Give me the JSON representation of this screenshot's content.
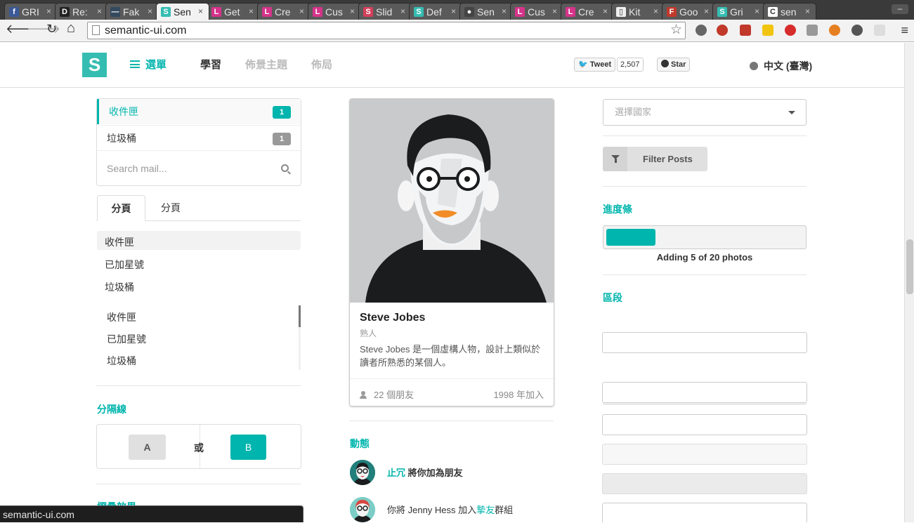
{
  "browser": {
    "tabs": [
      {
        "title": "GRI",
        "favicon_letter": "f",
        "favicon_color": "#3b5998"
      },
      {
        "title": "Re:",
        "favicon_letter": "D",
        "favicon_color": "#222222"
      },
      {
        "title": "Fak",
        "favicon_letter": "—",
        "favicon_color": "#34495e"
      },
      {
        "title": "Sen",
        "favicon_letter": "S",
        "favicon_color": "#35bdb2"
      },
      {
        "title": "Get",
        "favicon_letter": "L",
        "favicon_color": "#d6338a"
      },
      {
        "title": "Cre",
        "favicon_letter": "L",
        "favicon_color": "#d6338a"
      },
      {
        "title": "Cus",
        "favicon_letter": "L",
        "favicon_color": "#d6338a"
      },
      {
        "title": "Slid",
        "favicon_letter": "S",
        "favicon_color": "#d43f5a"
      },
      {
        "title": "Def",
        "favicon_letter": "S",
        "favicon_color": "#35bdb2"
      },
      {
        "title": "Sen",
        "favicon_letter": "●",
        "favicon_color": "#444444"
      },
      {
        "title": "Cus",
        "favicon_letter": "L",
        "favicon_color": "#d6338a"
      },
      {
        "title": "Cre",
        "favicon_letter": "L",
        "favicon_color": "#d6338a"
      },
      {
        "title": "Kit",
        "favicon_letter": "▯",
        "favicon_color": "#eeeeee"
      },
      {
        "title": "Goo",
        "favicon_letter": "F",
        "favicon_color": "#c0392b"
      },
      {
        "title": "Gri",
        "favicon_letter": "S",
        "favicon_color": "#35bdb2"
      },
      {
        "title": "sen",
        "favicon_letter": "C",
        "favicon_color": "#ffffff"
      }
    ],
    "active_tab": 3,
    "close_glyph": "×",
    "url": "semantic-ui.com",
    "back_glyph": "🡐",
    "forward_glyph": "🡒",
    "reload_glyph": "↻",
    "home_glyph": "⌂",
    "star_glyph": "☆",
    "menu_glyph": "≡",
    "minimize_glyph": "–",
    "status_text": "semantic-ui.com"
  },
  "site": {
    "logo_letter": "S",
    "menu_label": "選單",
    "nav": [
      "學習",
      "佈景主題",
      "佈局"
    ],
    "tweet_label": "Tweet",
    "tweet_count": "2,507",
    "star_label": "Star",
    "language": "中文 (臺灣)",
    "colors": {
      "accent": "#00b5ad",
      "logo": "#35bdb2",
      "badge_gray": "#999999"
    }
  },
  "mail_menu": {
    "items": [
      {
        "label": "收件匣",
        "count": "1",
        "active": true
      },
      {
        "label": "垃圾桶",
        "count": "1",
        "active": false
      }
    ],
    "search_placeholder": "Search mail..."
  },
  "tabs": [
    "分頁",
    "分頁"
  ],
  "secondary_menu": [
    "收件匣",
    "已加星號",
    "垃圾桶"
  ],
  "vertical_menu": [
    "收件匣",
    "已加星號",
    "垃圾桶"
  ],
  "divider_section": {
    "title": "分隔線",
    "button_a": "A",
    "or_label": "或",
    "button_b": "B"
  },
  "next_section_title": "摺疊效果",
  "card": {
    "name": "Steve Jobes",
    "meta": "熟人",
    "description": "Steve Jobes 是一個虛構人物，設計上類似於讀者所熟悉的某個人。",
    "friends": "22 個朋友",
    "joined": "1998 年加入"
  },
  "feed": {
    "title": "動態",
    "events": [
      {
        "link": "止冗",
        "text": " 將你加為朋友",
        "link_first": true
      },
      {
        "prefix": "你將 Jenny Hess 加入",
        "link": "摯友",
        "suffix": "群組"
      }
    ]
  },
  "right_column": {
    "country_placeholder": "選擇國家",
    "filter_label": "Filter Posts",
    "progress_title": "進度條",
    "progress_value": 0.25,
    "progress_label": "Adding 5 of 20 photos",
    "segment_title": "區段"
  }
}
